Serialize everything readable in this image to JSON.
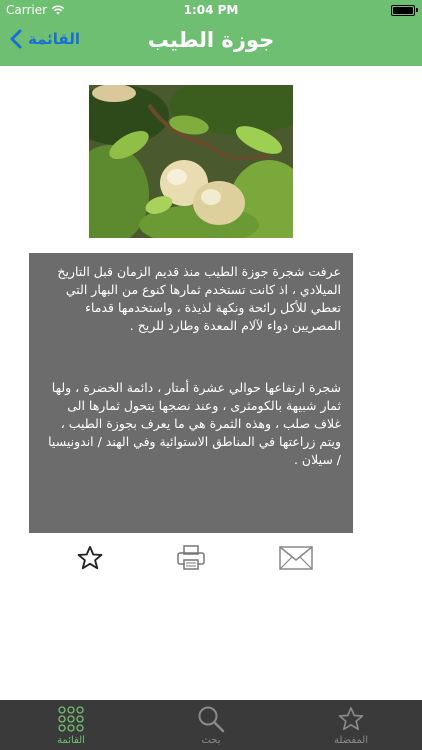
{
  "status_bar": {
    "carrier": "Carrier",
    "time": "1:04 PM"
  },
  "nav": {
    "back_label": "القائمة",
    "title": "جوزة الطيب",
    "background_color": "#6fbf73",
    "back_color": "#1a6fd6"
  },
  "photo": {
    "description_icon": "nutmeg-fruit-photo"
  },
  "content": {
    "paragraph_1": "عرفت شجرة جوزة الطيب منذ قديم الزمان قبل التاريخ الميلادي ، اذ كانت تستخدم ثمارها كنوع من البهار التي تعطي للأكل رائحة ونكهة لذيذة ، واستخدمها قدماء المصريين دواء لآلام المعدة وطارد للريح .",
    "paragraph_2": "شجرة ارتفاعها حوالي عشرة أمتار ، دائمة الخضرة ، ولها ثمار شبيهة بالكومثرى ، وعند نضجها يتحول ثمارها الى غلاف صلب ، وهذه الثمرة هي ما يعرف بجوزة الطيب ، ويتم زراعتها في المناطق الاستوائية وفي الهند / اندونيسيا / سيلان .",
    "panel_color": "#6c6c6c"
  },
  "actions": {
    "favorite_icon": "star-icon",
    "print_icon": "printer-icon",
    "mail_icon": "envelope-icon"
  },
  "tabbar": {
    "tabs": [
      {
        "label": "القائمة",
        "icon": "grid-icon",
        "active": true
      },
      {
        "label": "بحث",
        "icon": "search-icon",
        "active": false
      },
      {
        "label": "المفضلة",
        "icon": "star-icon",
        "active": false
      }
    ],
    "active_color": "#6fbf73",
    "inactive_color": "#8a8a8a"
  }
}
